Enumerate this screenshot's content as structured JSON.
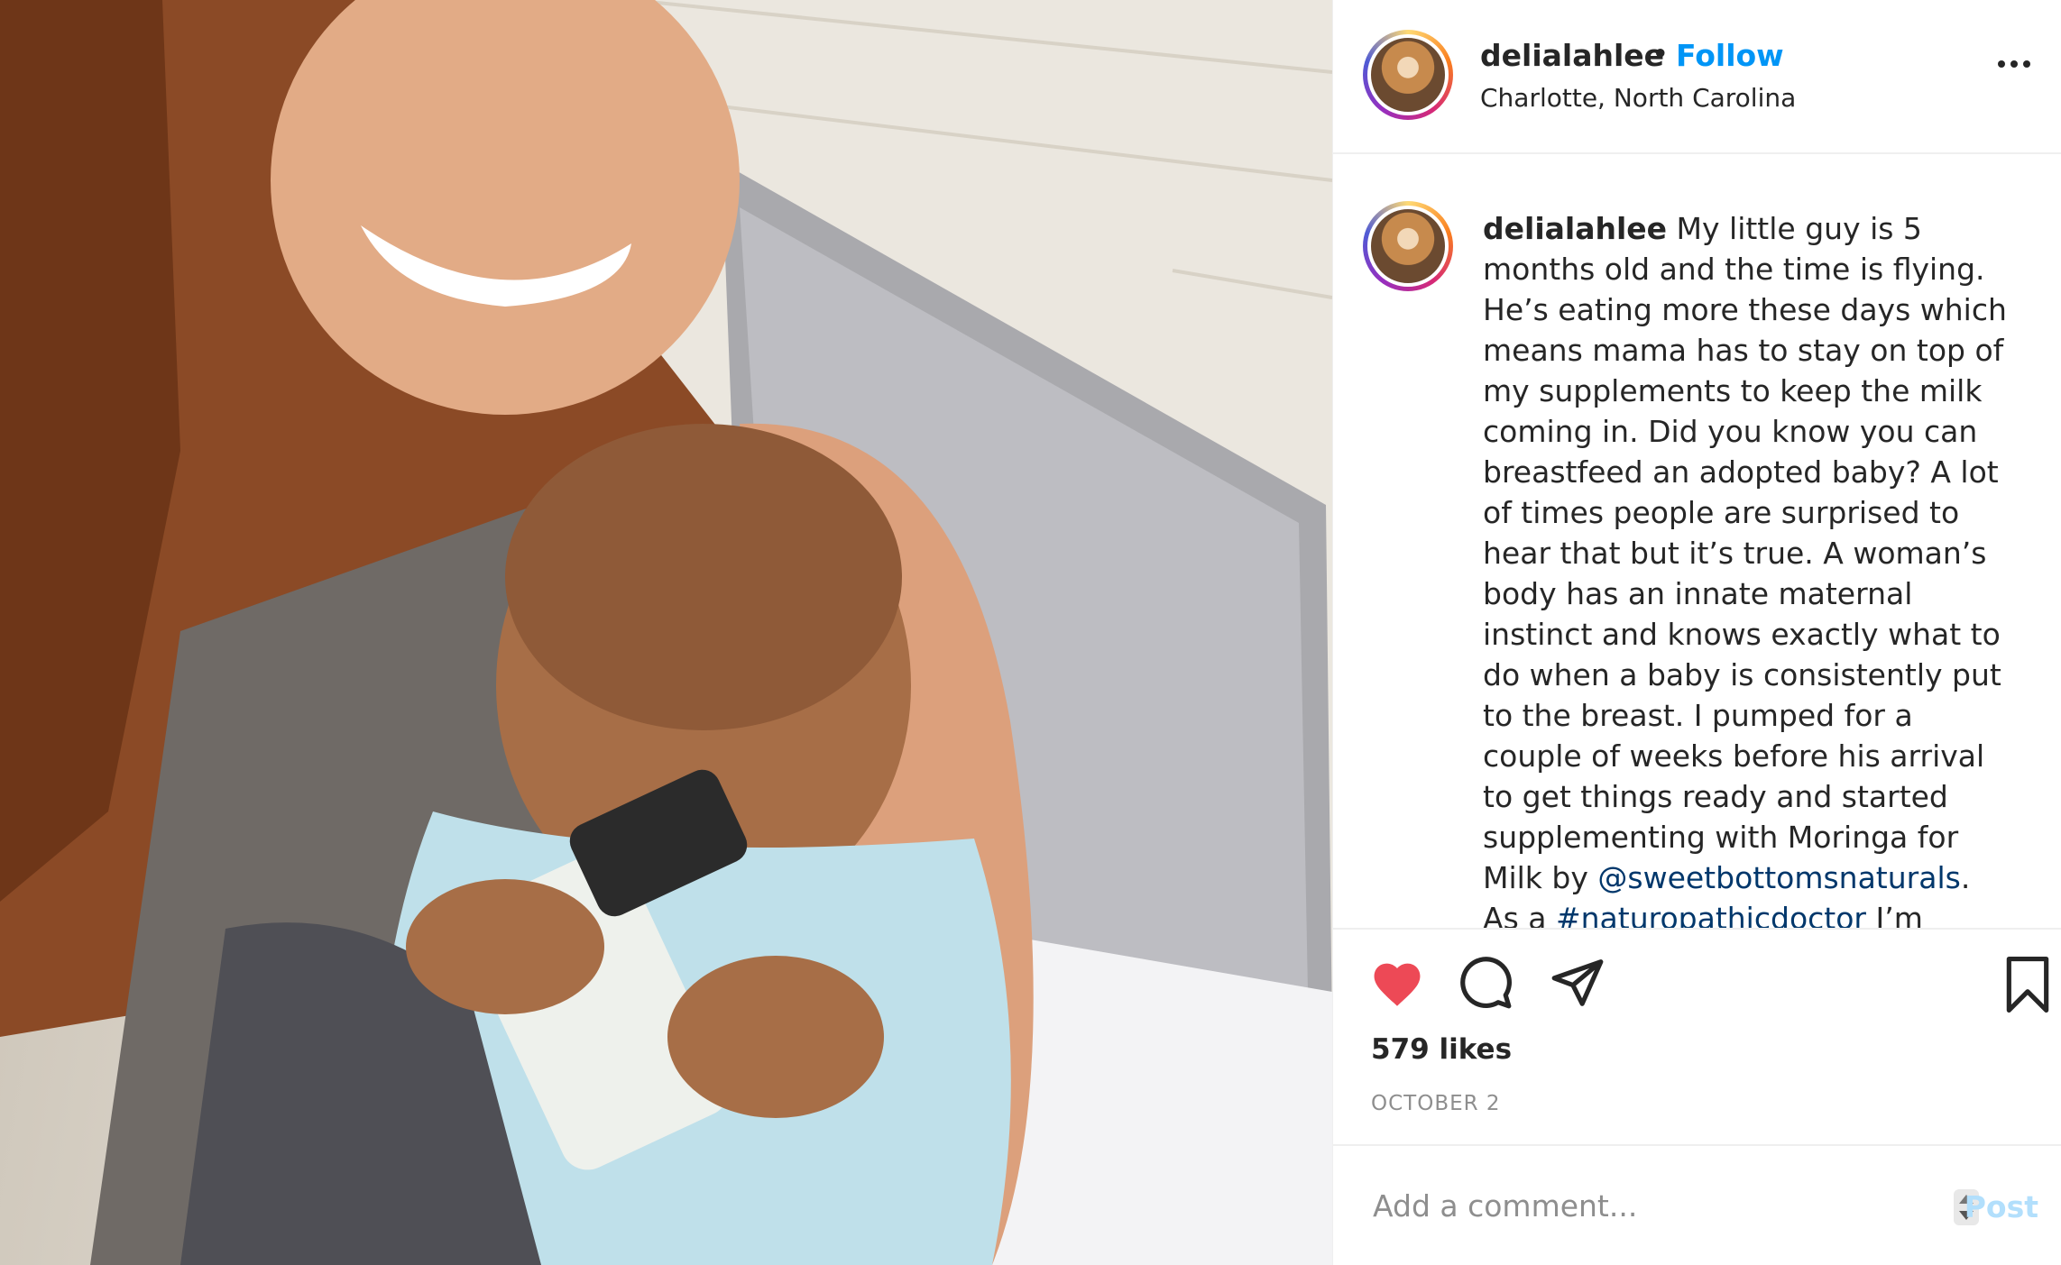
{
  "post": {
    "author": {
      "username": "delialahlee",
      "location": "Charlotte, North Carolina",
      "follow_label": "Follow",
      "separator": "•"
    },
    "caption": {
      "username": "delialahlee",
      "text_1": " My little guy is 5 months old and the time is flying. He’s eating more these days which means mama has to stay on top of my supplements to keep the milk coming in. Did you know you can breastfeed an adopted baby? A lot of times people are surprised to hear that but it’s true. A woman’s body has an innate maternal instinct and knows exactly what to do when a baby is consistently put to the breast. I pumped for a couple of weeks before his arrival to get things ready and started supplementing with Moringa for Milk by ",
      "mention": "@sweetbottomsnaturals",
      "text_2": ". As a ",
      "hashtag": "#naturopathicdoctor",
      "text_3": " I’m super picky about what supplements I use and this"
    },
    "likes": "579 likes",
    "date": "OCTOBER 2",
    "liked": true,
    "comment": {
      "placeholder": "Add a comment...",
      "post_label": "Post"
    }
  },
  "colors": {
    "like_red": "#ed4956",
    "follow_blue": "#0095f6",
    "link_blue": "#00376b",
    "post_disabled": "#b2dffc"
  },
  "icons": [
    "heart-icon",
    "comment-icon",
    "share-icon",
    "bookmark-icon",
    "more-options-icon"
  ]
}
